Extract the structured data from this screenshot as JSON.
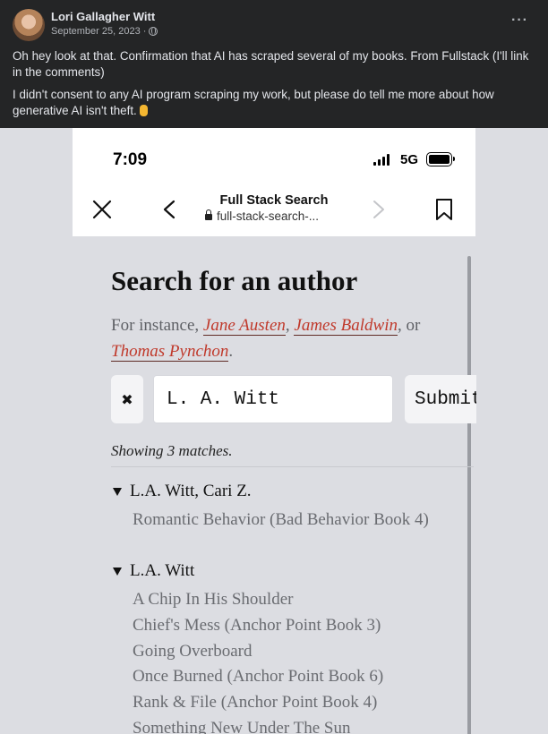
{
  "post": {
    "author": "Lori Gallagher Witt",
    "date": "September 25, 2023 ·",
    "paragraph1": "Oh hey look at that. Confirmation that AI has scraped several of my books. From Fullstack (I'll link in the comments)",
    "paragraph2": "I didn't consent to any AI program scraping my work, but please do tell me more about how generative AI isn't theft.",
    "more_label": "···",
    "emoji": "middle-finger-emoji"
  },
  "phone": {
    "time": "7:09",
    "network": "5G",
    "page_title": "Full Stack Search",
    "url": "full-stack-search-..."
  },
  "page": {
    "heading": "Search for an author",
    "instance_prefix": "For instance,",
    "examples": [
      "Jane Austen",
      "James Baldwin",
      "Thomas Pynchon"
    ],
    "sep1": ",",
    "sep2": ", or",
    "sep3": ".",
    "clear_label": "✖",
    "search_value": "L. A. Witt",
    "submit_label": "Submit",
    "matches_text": "Showing 3 matches.",
    "groups": [
      {
        "name": "L.A. Witt, Cari Z.",
        "books": [
          "Romantic Behavior (Bad Behavior Book 4)"
        ]
      },
      {
        "name": "L.A. Witt",
        "books": [
          "A Chip In His Shoulder",
          "Chief's Mess (Anchor Point Book 3)",
          "Going Overboard",
          "Once Burned (Anchor Point Book 6)",
          "Rank & File (Anchor Point Book 4)",
          "Something New Under The Sun"
        ]
      }
    ]
  },
  "colors": {
    "fb_background": "#242526",
    "page_background": "#dcdde2",
    "link_red": "#c0392b"
  }
}
